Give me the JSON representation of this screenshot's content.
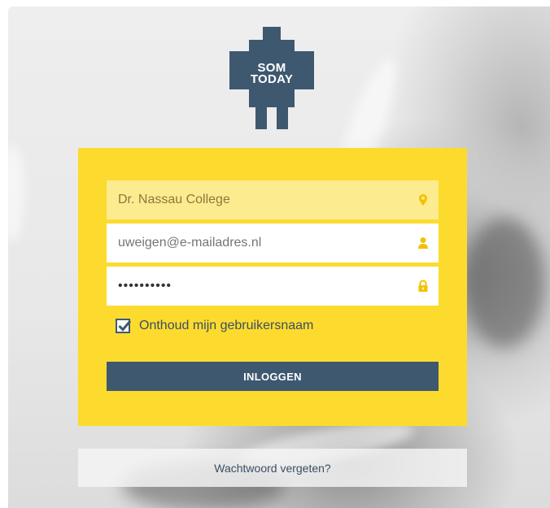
{
  "logo": {
    "line1": "SOM",
    "line2": "TODAY"
  },
  "login_form": {
    "school": {
      "value": "Dr. Nassau College",
      "icon": "location-pin-icon"
    },
    "email": {
      "placeholder": "uweigen@e-mailadres.nl",
      "icon": "user-icon"
    },
    "password": {
      "value": "••••••••••",
      "icon": "lock-icon"
    },
    "remember": {
      "label": "Onthoud mijn gebruikersnaam",
      "checked": true
    },
    "submit_label": "INLOGGEN"
  },
  "forgot_link": "Wachtwoord vergeten?",
  "colors": {
    "panel": "#fddb2e",
    "school_field": "#fdeb8f",
    "primary": "#3e5870",
    "icon": "#f2c200"
  }
}
